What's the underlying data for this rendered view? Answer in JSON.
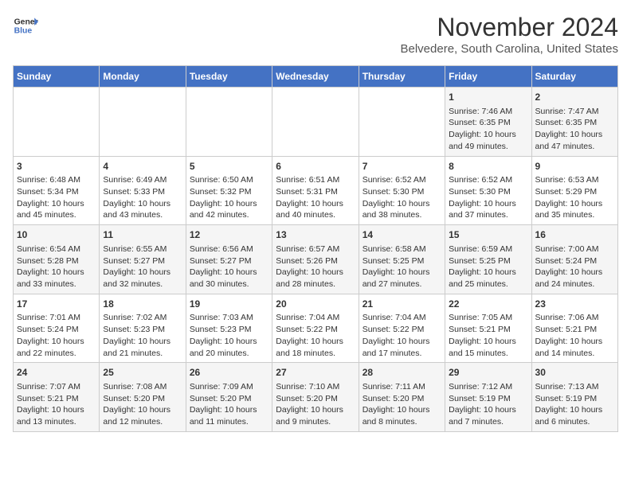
{
  "header": {
    "logo_line1": "General",
    "logo_line2": "Blue",
    "month": "November 2024",
    "location": "Belvedere, South Carolina, United States"
  },
  "weekdays": [
    "Sunday",
    "Monday",
    "Tuesday",
    "Wednesday",
    "Thursday",
    "Friday",
    "Saturday"
  ],
  "weeks": [
    [
      {
        "day": "",
        "info": ""
      },
      {
        "day": "",
        "info": ""
      },
      {
        "day": "",
        "info": ""
      },
      {
        "day": "",
        "info": ""
      },
      {
        "day": "",
        "info": ""
      },
      {
        "day": "1",
        "info": "Sunrise: 7:46 AM\nSunset: 6:35 PM\nDaylight: 10 hours\nand 49 minutes."
      },
      {
        "day": "2",
        "info": "Sunrise: 7:47 AM\nSunset: 6:35 PM\nDaylight: 10 hours\nand 47 minutes."
      }
    ],
    [
      {
        "day": "3",
        "info": "Sunrise: 6:48 AM\nSunset: 5:34 PM\nDaylight: 10 hours\nand 45 minutes."
      },
      {
        "day": "4",
        "info": "Sunrise: 6:49 AM\nSunset: 5:33 PM\nDaylight: 10 hours\nand 43 minutes."
      },
      {
        "day": "5",
        "info": "Sunrise: 6:50 AM\nSunset: 5:32 PM\nDaylight: 10 hours\nand 42 minutes."
      },
      {
        "day": "6",
        "info": "Sunrise: 6:51 AM\nSunset: 5:31 PM\nDaylight: 10 hours\nand 40 minutes."
      },
      {
        "day": "7",
        "info": "Sunrise: 6:52 AM\nSunset: 5:30 PM\nDaylight: 10 hours\nand 38 minutes."
      },
      {
        "day": "8",
        "info": "Sunrise: 6:52 AM\nSunset: 5:30 PM\nDaylight: 10 hours\nand 37 minutes."
      },
      {
        "day": "9",
        "info": "Sunrise: 6:53 AM\nSunset: 5:29 PM\nDaylight: 10 hours\nand 35 minutes."
      }
    ],
    [
      {
        "day": "10",
        "info": "Sunrise: 6:54 AM\nSunset: 5:28 PM\nDaylight: 10 hours\nand 33 minutes."
      },
      {
        "day": "11",
        "info": "Sunrise: 6:55 AM\nSunset: 5:27 PM\nDaylight: 10 hours\nand 32 minutes."
      },
      {
        "day": "12",
        "info": "Sunrise: 6:56 AM\nSunset: 5:27 PM\nDaylight: 10 hours\nand 30 minutes."
      },
      {
        "day": "13",
        "info": "Sunrise: 6:57 AM\nSunset: 5:26 PM\nDaylight: 10 hours\nand 28 minutes."
      },
      {
        "day": "14",
        "info": "Sunrise: 6:58 AM\nSunset: 5:25 PM\nDaylight: 10 hours\nand 27 minutes."
      },
      {
        "day": "15",
        "info": "Sunrise: 6:59 AM\nSunset: 5:25 PM\nDaylight: 10 hours\nand 25 minutes."
      },
      {
        "day": "16",
        "info": "Sunrise: 7:00 AM\nSunset: 5:24 PM\nDaylight: 10 hours\nand 24 minutes."
      }
    ],
    [
      {
        "day": "17",
        "info": "Sunrise: 7:01 AM\nSunset: 5:24 PM\nDaylight: 10 hours\nand 22 minutes."
      },
      {
        "day": "18",
        "info": "Sunrise: 7:02 AM\nSunset: 5:23 PM\nDaylight: 10 hours\nand 21 minutes."
      },
      {
        "day": "19",
        "info": "Sunrise: 7:03 AM\nSunset: 5:23 PM\nDaylight: 10 hours\nand 20 minutes."
      },
      {
        "day": "20",
        "info": "Sunrise: 7:04 AM\nSunset: 5:22 PM\nDaylight: 10 hours\nand 18 minutes."
      },
      {
        "day": "21",
        "info": "Sunrise: 7:04 AM\nSunset: 5:22 PM\nDaylight: 10 hours\nand 17 minutes."
      },
      {
        "day": "22",
        "info": "Sunrise: 7:05 AM\nSunset: 5:21 PM\nDaylight: 10 hours\nand 15 minutes."
      },
      {
        "day": "23",
        "info": "Sunrise: 7:06 AM\nSunset: 5:21 PM\nDaylight: 10 hours\nand 14 minutes."
      }
    ],
    [
      {
        "day": "24",
        "info": "Sunrise: 7:07 AM\nSunset: 5:21 PM\nDaylight: 10 hours\nand 13 minutes."
      },
      {
        "day": "25",
        "info": "Sunrise: 7:08 AM\nSunset: 5:20 PM\nDaylight: 10 hours\nand 12 minutes."
      },
      {
        "day": "26",
        "info": "Sunrise: 7:09 AM\nSunset: 5:20 PM\nDaylight: 10 hours\nand 11 minutes."
      },
      {
        "day": "27",
        "info": "Sunrise: 7:10 AM\nSunset: 5:20 PM\nDaylight: 10 hours\nand 9 minutes."
      },
      {
        "day": "28",
        "info": "Sunrise: 7:11 AM\nSunset: 5:20 PM\nDaylight: 10 hours\nand 8 minutes."
      },
      {
        "day": "29",
        "info": "Sunrise: 7:12 AM\nSunset: 5:19 PM\nDaylight: 10 hours\nand 7 minutes."
      },
      {
        "day": "30",
        "info": "Sunrise: 7:13 AM\nSunset: 5:19 PM\nDaylight: 10 hours\nand 6 minutes."
      }
    ]
  ]
}
